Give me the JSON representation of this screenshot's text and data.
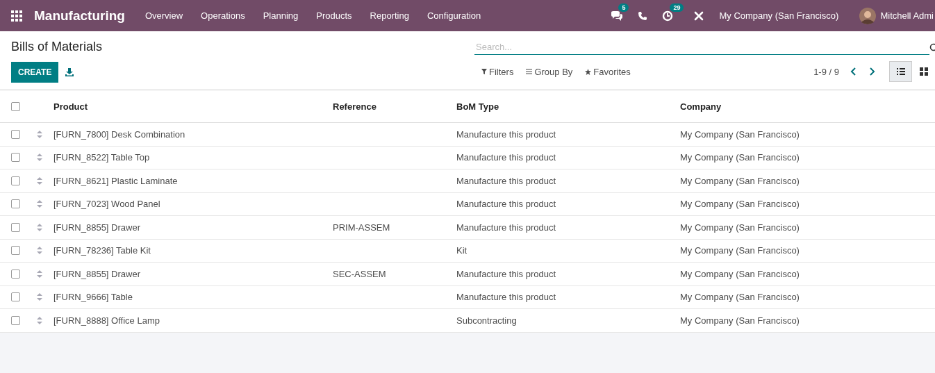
{
  "navbar": {
    "app": "Manufacturing",
    "menu": [
      "Overview",
      "Operations",
      "Planning",
      "Products",
      "Reporting",
      "Configuration"
    ],
    "messages_badge": "5",
    "activities_badge": "29",
    "company": "My Company (San Francisco)",
    "user": "Mitchell Admi"
  },
  "page": {
    "title": "Bills of Materials",
    "create": "CREATE"
  },
  "search": {
    "placeholder": "Search..."
  },
  "filters": [
    "Filters",
    "Group By",
    "Favorites"
  ],
  "pager": "1-9 / 9",
  "views": [
    {
      "kind": "list",
      "selected": true
    },
    {
      "kind": "kanban",
      "selected": false
    }
  ],
  "table": {
    "select_all": {
      "checked": false
    },
    "columns": [
      "Product",
      "Reference",
      "BoM Type",
      "Company"
    ],
    "rows": [
      {
        "checked": false,
        "product": "[FURN_7800] Desk Combination",
        "reference": "",
        "bom_type": "Manufacture this product",
        "company": "My Company (San Francisco)"
      },
      {
        "checked": false,
        "product": "[FURN_8522] Table Top",
        "reference": "",
        "bom_type": "Manufacture this product",
        "company": "My Company (San Francisco)"
      },
      {
        "checked": false,
        "product": "[FURN_8621] Plastic Laminate",
        "reference": "",
        "bom_type": "Manufacture this product",
        "company": "My Company (San Francisco)"
      },
      {
        "checked": false,
        "product": "[FURN_7023] Wood Panel",
        "reference": "",
        "bom_type": "Manufacture this product",
        "company": "My Company (San Francisco)"
      },
      {
        "checked": false,
        "product": "[FURN_8855] Drawer",
        "reference": "PRIM-ASSEM",
        "bom_type": "Manufacture this product",
        "company": "My Company (San Francisco)"
      },
      {
        "checked": false,
        "product": "[FURN_78236] Table Kit",
        "reference": "",
        "bom_type": "Kit",
        "company": "My Company (San Francisco)"
      },
      {
        "checked": false,
        "product": "[FURN_8855] Drawer",
        "reference": "SEC-ASSEM",
        "bom_type": "Manufacture this product",
        "company": "My Company (San Francisco)"
      },
      {
        "checked": false,
        "product": "[FURN_9666] Table",
        "reference": "",
        "bom_type": "Manufacture this product",
        "company": "My Company (San Francisco)"
      },
      {
        "checked": false,
        "product": "[FURN_8888] Office Lamp",
        "reference": "",
        "bom_type": "Subcontracting",
        "company": "My Company (San Francisco)"
      }
    ]
  }
}
